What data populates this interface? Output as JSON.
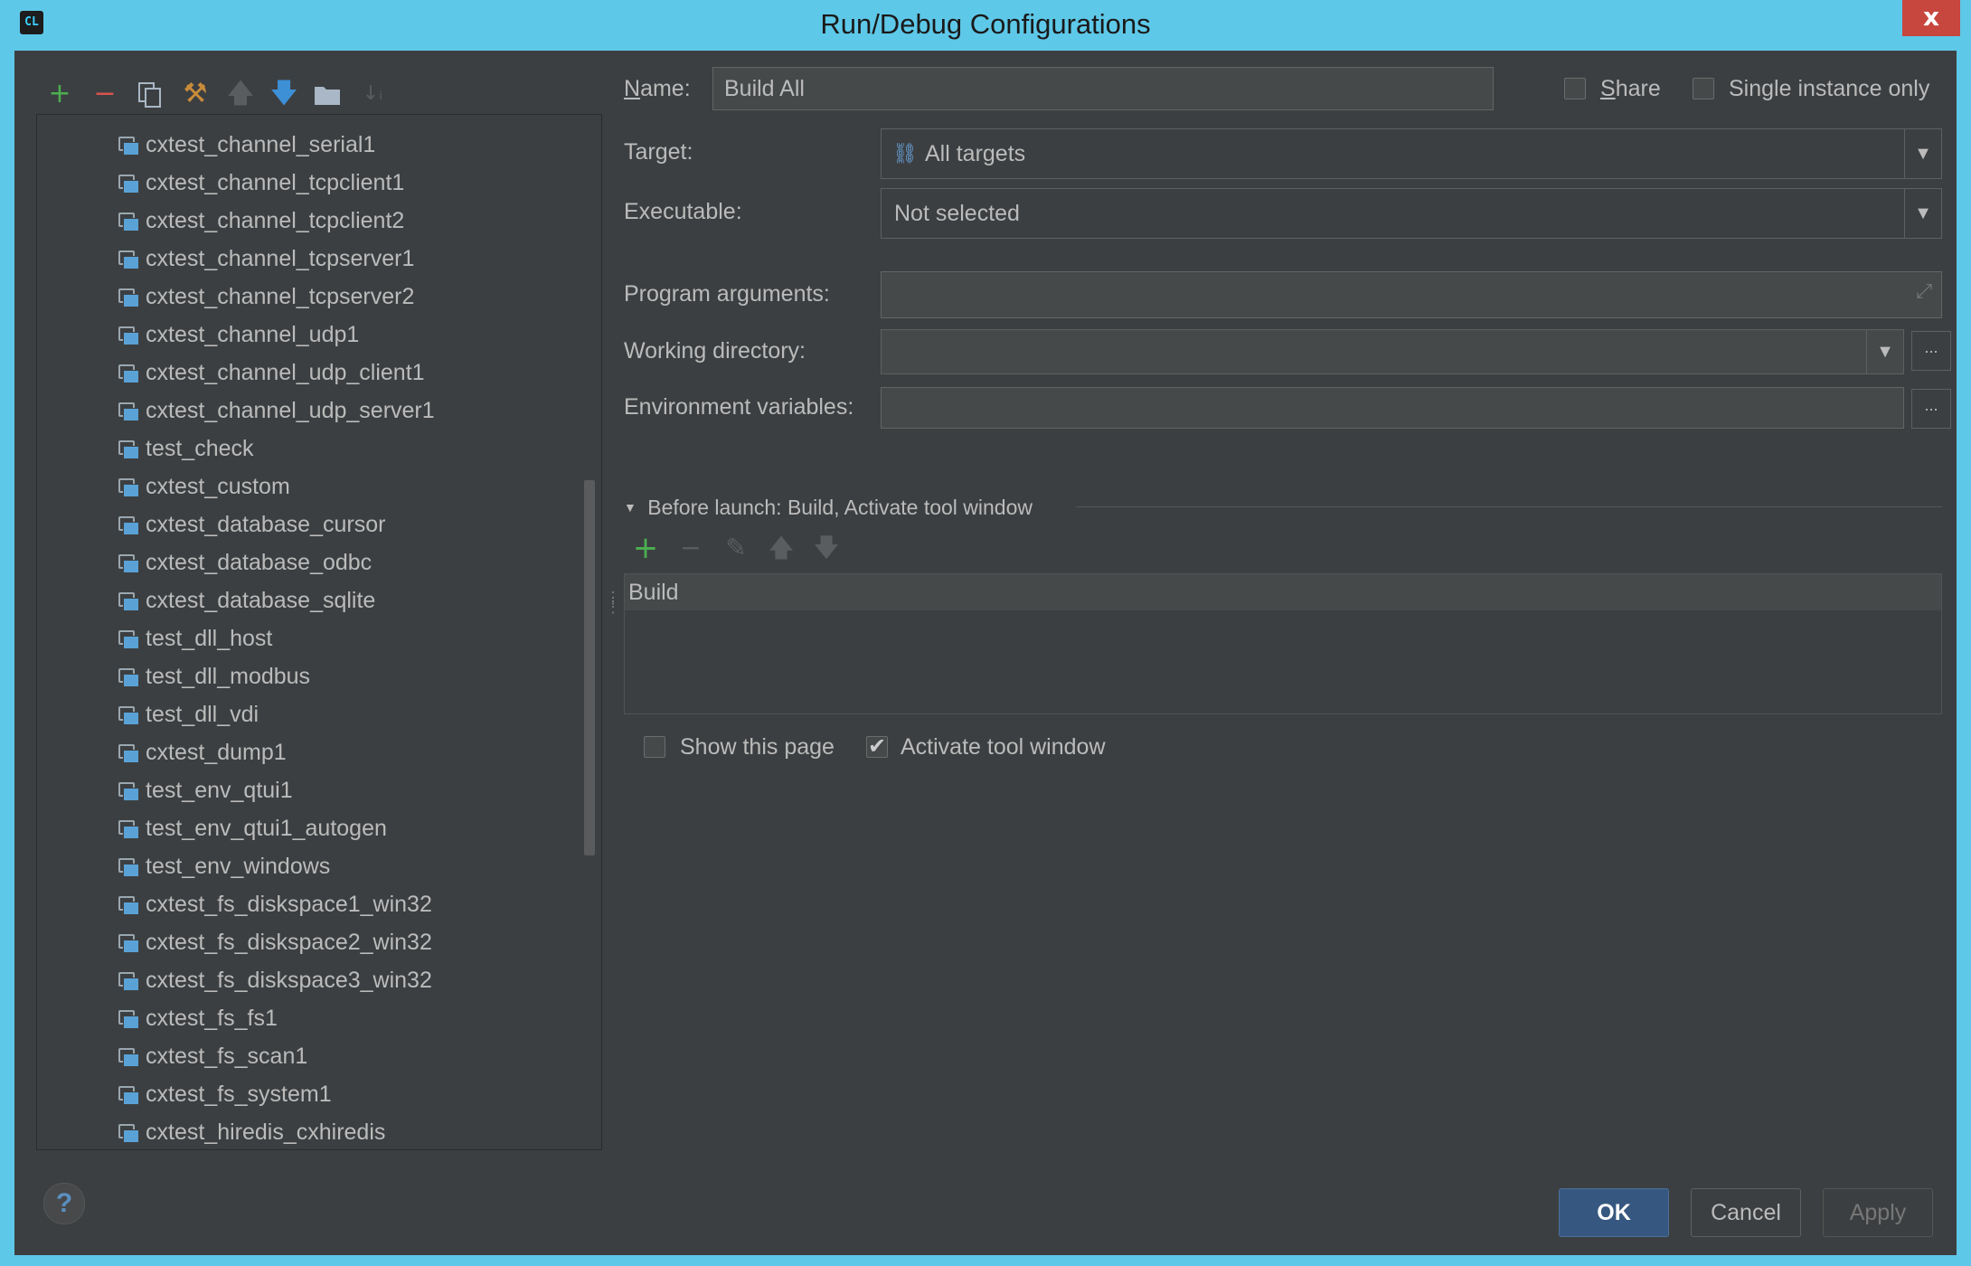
{
  "window": {
    "title": "Run/Debug Configurations",
    "close_label": "x",
    "app_icon_label": "CL"
  },
  "tree": {
    "items": [
      "cxtest_channel_serial1",
      "cxtest_channel_tcpclient1",
      "cxtest_channel_tcpclient2",
      "cxtest_channel_tcpserver1",
      "cxtest_channel_tcpserver2",
      "cxtest_channel_udp1",
      "cxtest_channel_udp_client1",
      "cxtest_channel_udp_server1",
      "test_check",
      "cxtest_custom",
      "cxtest_database_cursor",
      "cxtest_database_odbc",
      "cxtest_database_sqlite",
      "test_dll_host",
      "test_dll_modbus",
      "test_dll_vdi",
      "cxtest_dump1",
      "test_env_qtui1",
      "test_env_qtui1_autogen",
      "test_env_windows",
      "cxtest_fs_diskspace1_win32",
      "cxtest_fs_diskspace2_win32",
      "cxtest_fs_diskspace3_win32",
      "cxtest_fs_fs1",
      "cxtest_fs_scan1",
      "cxtest_fs_system1",
      "cxtest_hiredis_cxhiredis"
    ]
  },
  "form": {
    "name_label": "Name:",
    "name_value": "Build All",
    "share_label": "Share",
    "single_instance_label": "Single instance only",
    "target_label": "Target:",
    "target_value": "All targets",
    "executable_label": "Executable:",
    "executable_value": "Not selected",
    "program_args_label": "Program arguments:",
    "working_dir_label": "Working directory:",
    "env_vars_label": "Environment variables:",
    "dots": "..."
  },
  "before_launch": {
    "header": "Before launch: Build, Activate tool window",
    "items": [
      "Build"
    ],
    "show_page_label": "Show this page",
    "show_page_checked": false,
    "activate_tool_label": "Activate tool window",
    "activate_tool_checked": true
  },
  "buttons": {
    "ok": "OK",
    "cancel": "Cancel",
    "apply": "Apply",
    "help": "?"
  },
  "colors": {
    "background": "#3c3f41",
    "titlebar": "#5ec8e8",
    "add_green": "#4caf50",
    "remove_red": "#d9534f",
    "arrow_blue": "#3d8fd6",
    "primary_button": "#365880"
  }
}
